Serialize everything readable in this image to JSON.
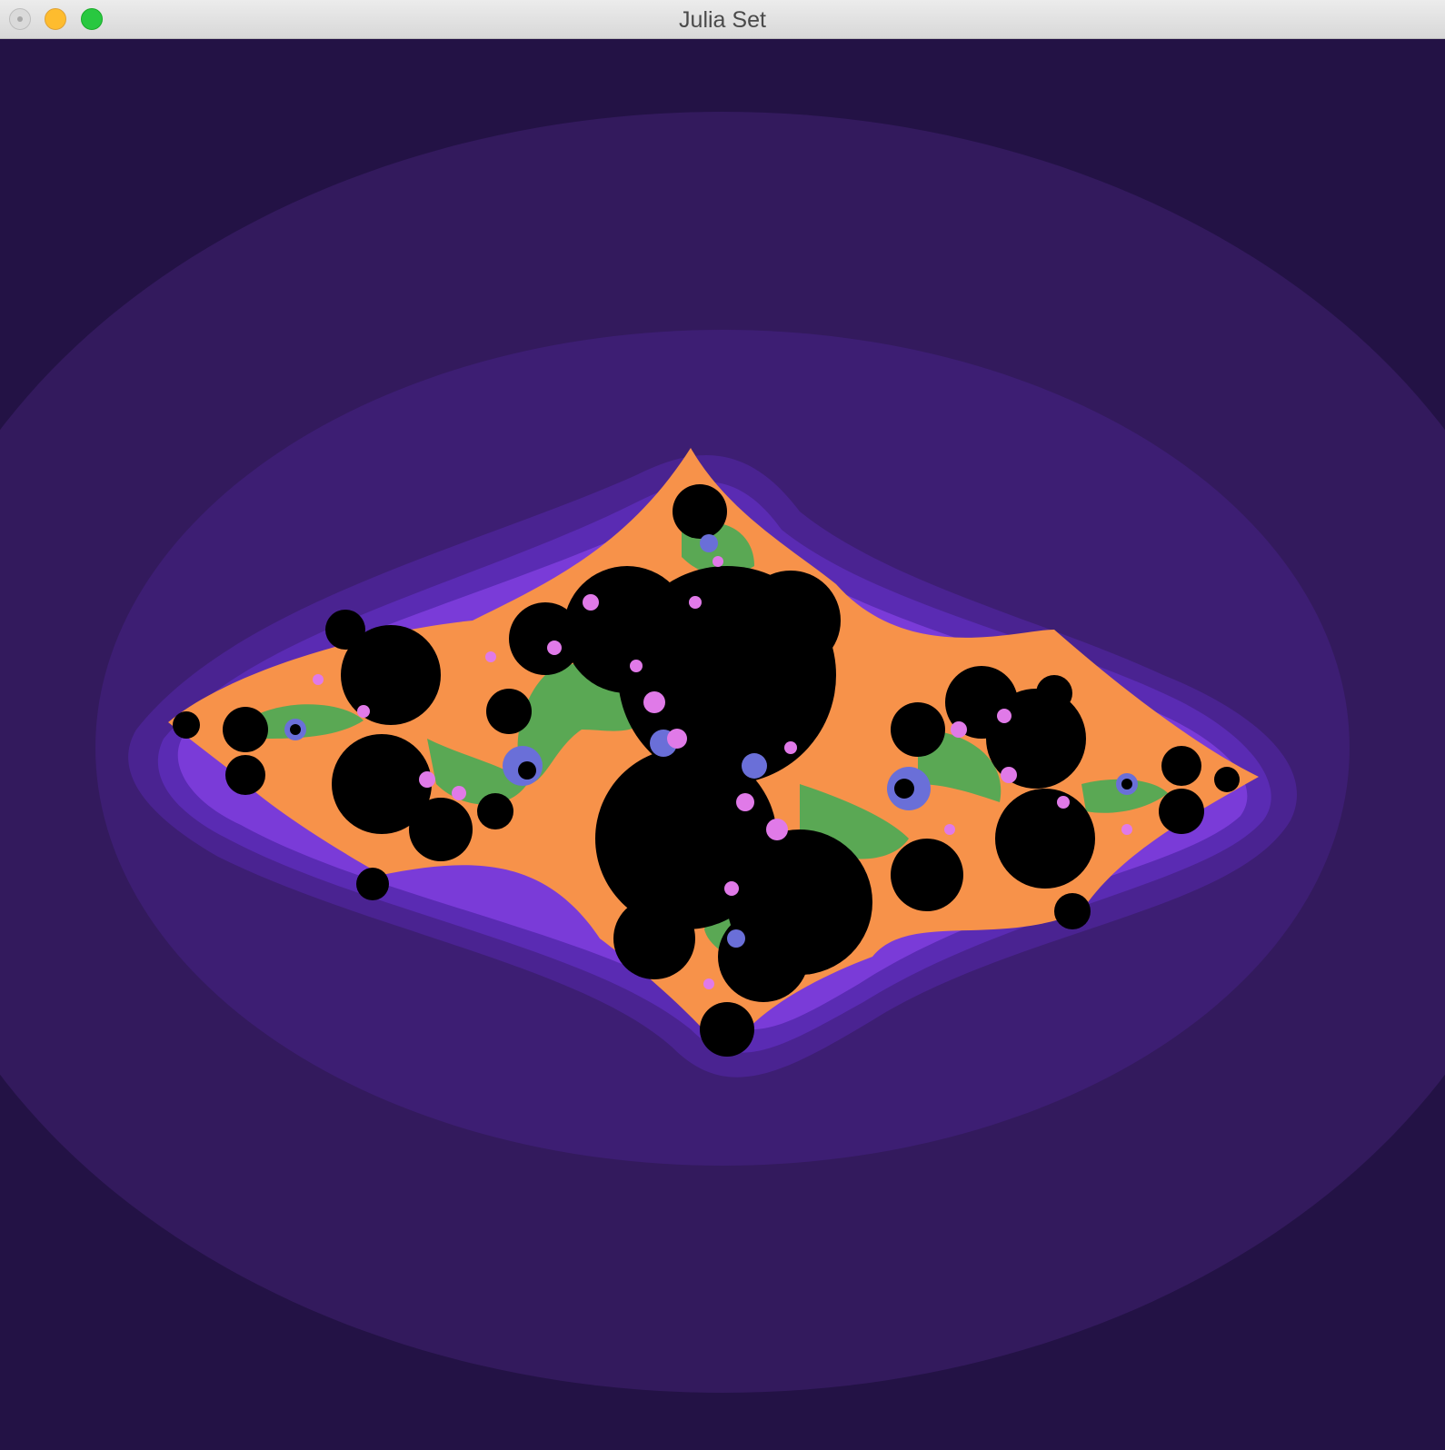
{
  "window": {
    "title": "Julia Set"
  },
  "colors": {
    "background": "#231245",
    "band_1": "#331a5d",
    "band_2": "#3d1e73",
    "band_3": "#4a2391",
    "band_4": "#5a2bb3",
    "band_5": "#7a3bd8",
    "orange": "#f7924a",
    "green": "#5aa854",
    "blue": "#6a6fd8",
    "pink": "#e07ae8",
    "set_interior": "#000000"
  }
}
